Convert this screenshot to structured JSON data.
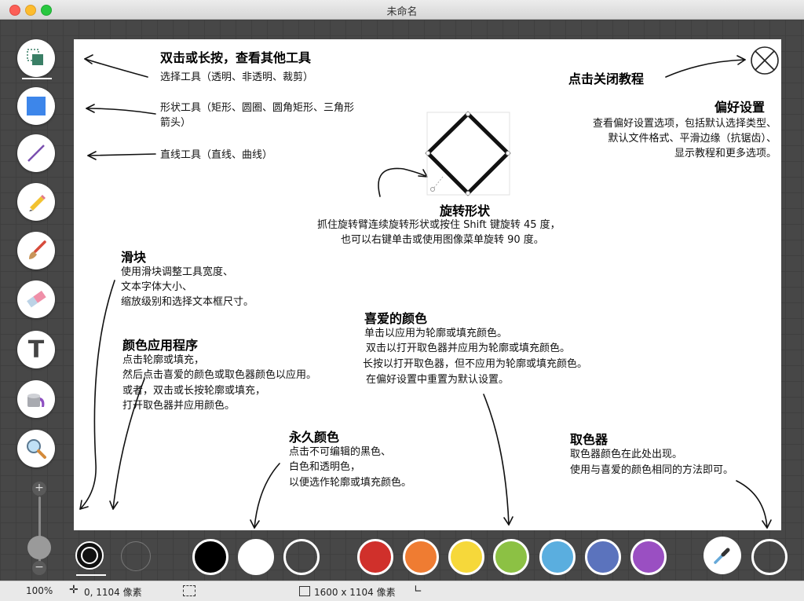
{
  "window": {
    "title": "未命名"
  },
  "tutorial": {
    "double_click_title": "双击或长按，查看其他工具",
    "select_tool": "选择工具（透明、非透明、裁剪）",
    "shape_tool_line1": "形状工具（矩形、圆圈、圆角矩形、三角形",
    "shape_tool_line2": "箭头）",
    "line_tool": "直线工具（直线、曲线）",
    "close_title": "点击关闭教程",
    "prefs_title": "偏好设置",
    "prefs_line1": "查看偏好设置选项，包括默认选择类型、",
    "prefs_line2": "默认文件格式、平滑边缘（抗锯齿）、",
    "prefs_line3": "显示教程和更多选项。",
    "rotate_title": "旋转形状",
    "rotate_line1": "抓住旋转臂连续旋转形状或按住 Shift 键旋转 45 度，",
    "rotate_line2": "也可以右键单击或使用图像菜单旋转 90 度。",
    "slider_title": "滑块",
    "slider_line1": "使用滑块调整工具宽度、",
    "slider_line2": "文本字体大小、",
    "slider_line3": "缩放级别和选择文本框尺寸。",
    "color_app_title": "颜色应用程序",
    "color_app_line1": "点击轮廓或填充，",
    "color_app_line2": "然后点击喜爱的颜色或取色器颜色以应用。",
    "color_app_line3": "或者，双击或长按轮廓或填充，",
    "color_app_line4": "打开取色器并应用颜色。",
    "fav_title": "喜爱的颜色",
    "fav_line1": "单击以应用为轮廓或填充颜色。",
    "fav_line2": "双击以打开取色器并应用为轮廓或填充颜色。",
    "fav_line3": "长按以打开取色器，但不应用为轮廓或填充颜色。",
    "fav_line4": "在偏好设置中重置为默认设置。",
    "perm_title": "永久颜色",
    "perm_line1": "点击不可编辑的黑色、",
    "perm_line2": "白色和透明色，",
    "perm_line3": "以便选作轮廓或填充颜色。",
    "picker_title": "取色器",
    "picker_line1": "取色器颜色在此处出现。",
    "picker_line2": "使用与喜爱的颜色相同的方法即可。"
  },
  "colors": {
    "permanent": [
      "#000000",
      "#ffffff",
      "transparent"
    ],
    "favorites": [
      "#d0302b",
      "#ef7c32",
      "#f6d83a",
      "#8cc144",
      "#5aaedf",
      "#5b73bd",
      "#9a4fc2"
    ]
  },
  "slider": {
    "plus": "+",
    "minus": "−"
  },
  "status": {
    "zoom": "100%",
    "cursor": "0, 1104 像素",
    "size": "1600 x 1104 像素"
  }
}
